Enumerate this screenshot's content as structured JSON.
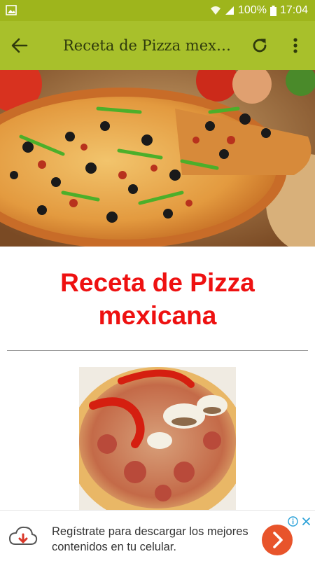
{
  "status_bar": {
    "battery": "100%",
    "time": "17:04"
  },
  "app_bar": {
    "title": "Receta de Pizza mexicana"
  },
  "recipe": {
    "title": "Receta de Pizza mexicana"
  },
  "ad": {
    "text": "Regístrate para descargar los mejores contenidos en tu celular."
  },
  "colors": {
    "status_bar": "#9eb51c",
    "app_bar": "#a8c02b",
    "title": "#ee1111",
    "ad_button": "#e8542b"
  }
}
